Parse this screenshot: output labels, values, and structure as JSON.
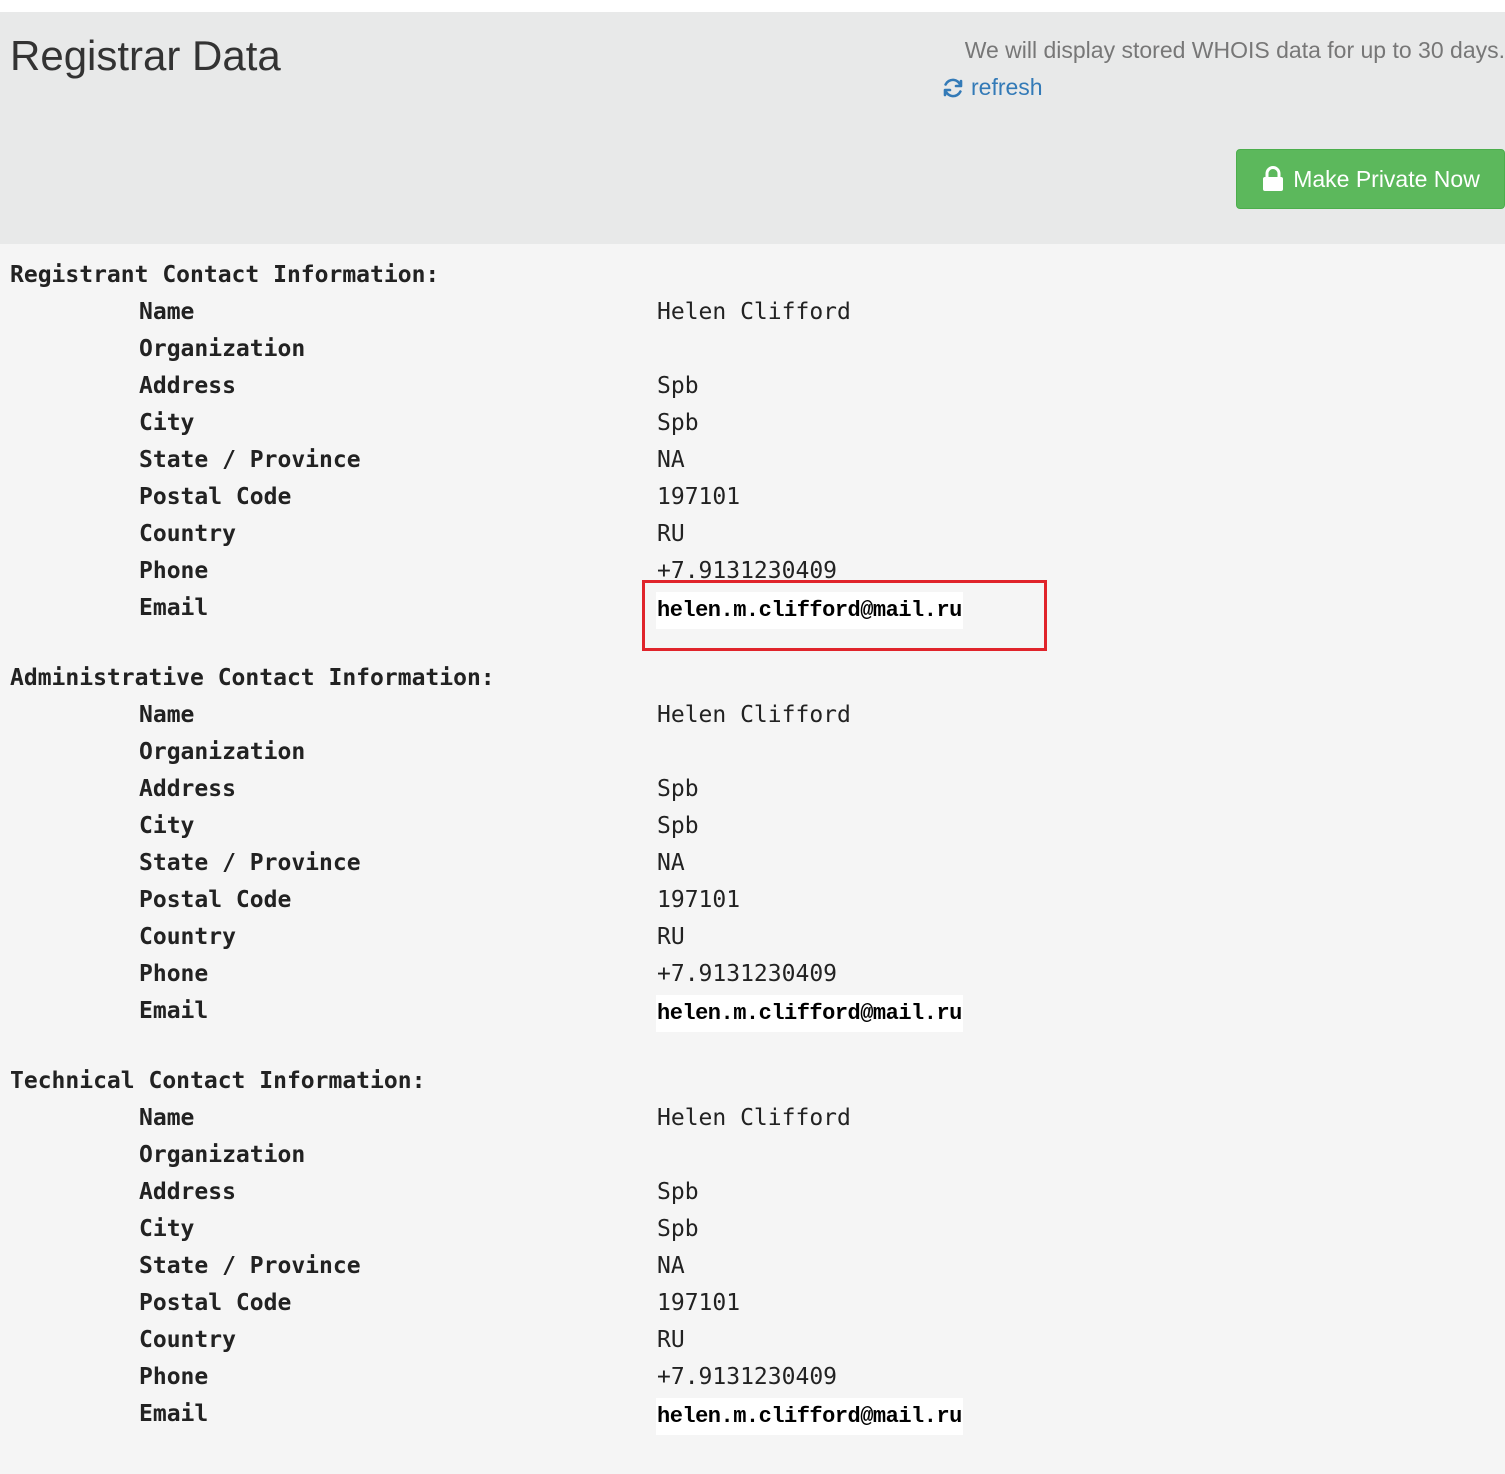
{
  "header": {
    "title": "Registrar Data",
    "notice": "We will display stored WHOIS data for up to 30 days.",
    "refresh_label": "refresh",
    "private_button_label": "Make Private Now"
  },
  "sections": [
    {
      "title": "Registrant Contact Information:",
      "fields": {
        "name_label": "Name",
        "name_value": "Helen Clifford",
        "organization_label": "Organization",
        "organization_value": "",
        "address_label": "Address",
        "address_value": "Spb",
        "city_label": "City",
        "city_value": "Spb",
        "state_label": "State / Province",
        "state_value": "NA",
        "postal_label": "Postal Code",
        "postal_value": "197101",
        "country_label": "Country",
        "country_value": "RU",
        "phone_label": "Phone",
        "phone_value": "+7.9131230409",
        "email_label": "Email",
        "email_value": "helen.m.clifford@mail.ru"
      }
    },
    {
      "title": "Administrative Contact Information:",
      "fields": {
        "name_label": "Name",
        "name_value": "Helen Clifford",
        "organization_label": "Organization",
        "organization_value": "",
        "address_label": "Address",
        "address_value": "Spb",
        "city_label": "City",
        "city_value": "Spb",
        "state_label": "State / Province",
        "state_value": "NA",
        "postal_label": "Postal Code",
        "postal_value": "197101",
        "country_label": "Country",
        "country_value": "RU",
        "phone_label": "Phone",
        "phone_value": "+7.9131230409",
        "email_label": "Email",
        "email_value": "helen.m.clifford@mail.ru"
      }
    },
    {
      "title": "Technical Contact Information:",
      "fields": {
        "name_label": "Name",
        "name_value": "Helen Clifford",
        "organization_label": "Organization",
        "organization_value": "",
        "address_label": "Address",
        "address_value": "Spb",
        "city_label": "City",
        "city_value": "Spb",
        "state_label": "State / Province",
        "state_value": "NA",
        "postal_label": "Postal Code",
        "postal_value": "197101",
        "country_label": "Country",
        "country_value": "RU",
        "phone_label": "Phone",
        "phone_value": "+7.9131230409",
        "email_label": "Email",
        "email_value": "helen.m.clifford@mail.ru"
      }
    }
  ],
  "icons": {
    "refresh": "refresh-icon",
    "lock": "lock-icon"
  },
  "colors": {
    "header_bg": "#e8e9e9",
    "body_bg": "#f5f5f5",
    "link": "#337ab7",
    "button_green": "#5cb85c",
    "highlight_red": "#e0242b"
  }
}
